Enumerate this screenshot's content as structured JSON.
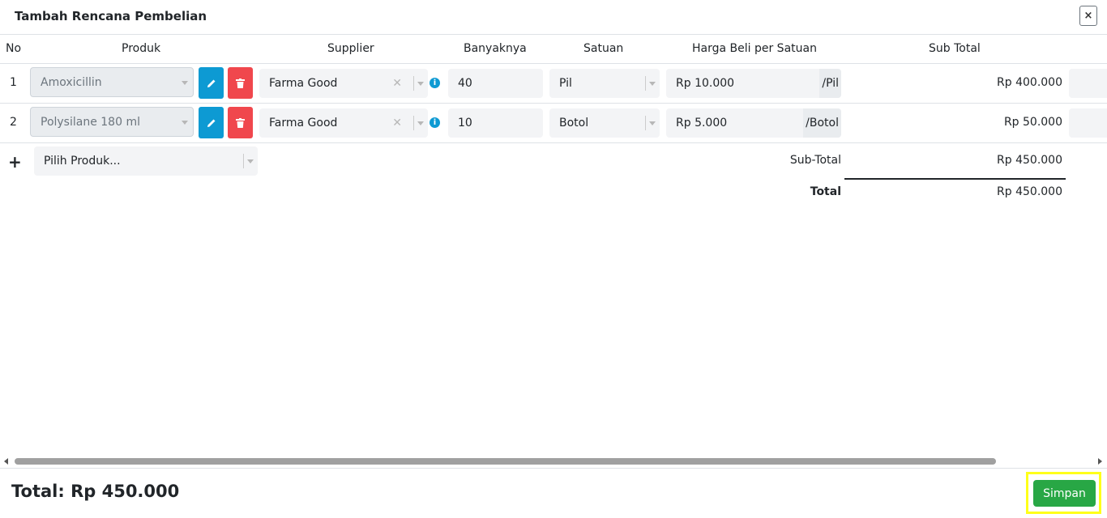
{
  "modal": {
    "title": "Tambah Rencana Pembelian",
    "close_label": "×"
  },
  "table": {
    "headers": [
      "No",
      "Produk",
      "Supplier",
      "Banyaknya",
      "Satuan",
      "Harga Beli per Satuan",
      "Sub Total"
    ],
    "rows": [
      {
        "no": "1",
        "product": "Amoxicillin",
        "supplier": "Farma Good",
        "qty": "40",
        "unit": "Pil",
        "price": "Rp 10.000",
        "price_suffix": "/Pil",
        "subtotal": "Rp 400.000"
      },
      {
        "no": "2",
        "product": "Polysilane 180 ml",
        "supplier": "Farma Good",
        "qty": "10",
        "unit": "Botol",
        "price": "Rp 5.000",
        "price_suffix": "/Botol",
        "subtotal": "Rp 50.000"
      }
    ],
    "add_product_placeholder": "Pilih Produk...",
    "add_icon": "+"
  },
  "summary": {
    "subtotal_label": "Sub-Total",
    "subtotal_value": "Rp 450.000",
    "total_label": "Total",
    "total_value": "Rp 450.000"
  },
  "footer": {
    "grand_total": "Total: Rp 450.000",
    "save_label": "Simpan"
  },
  "icons": {
    "edit": "pencil-icon",
    "delete": "trash-icon",
    "info": "info-icon",
    "close": "close-icon"
  },
  "colors": {
    "edit_button": "#0d9ad3",
    "delete_button": "#f0474d",
    "save_button": "#28a745",
    "highlight": "#ffff1a"
  }
}
